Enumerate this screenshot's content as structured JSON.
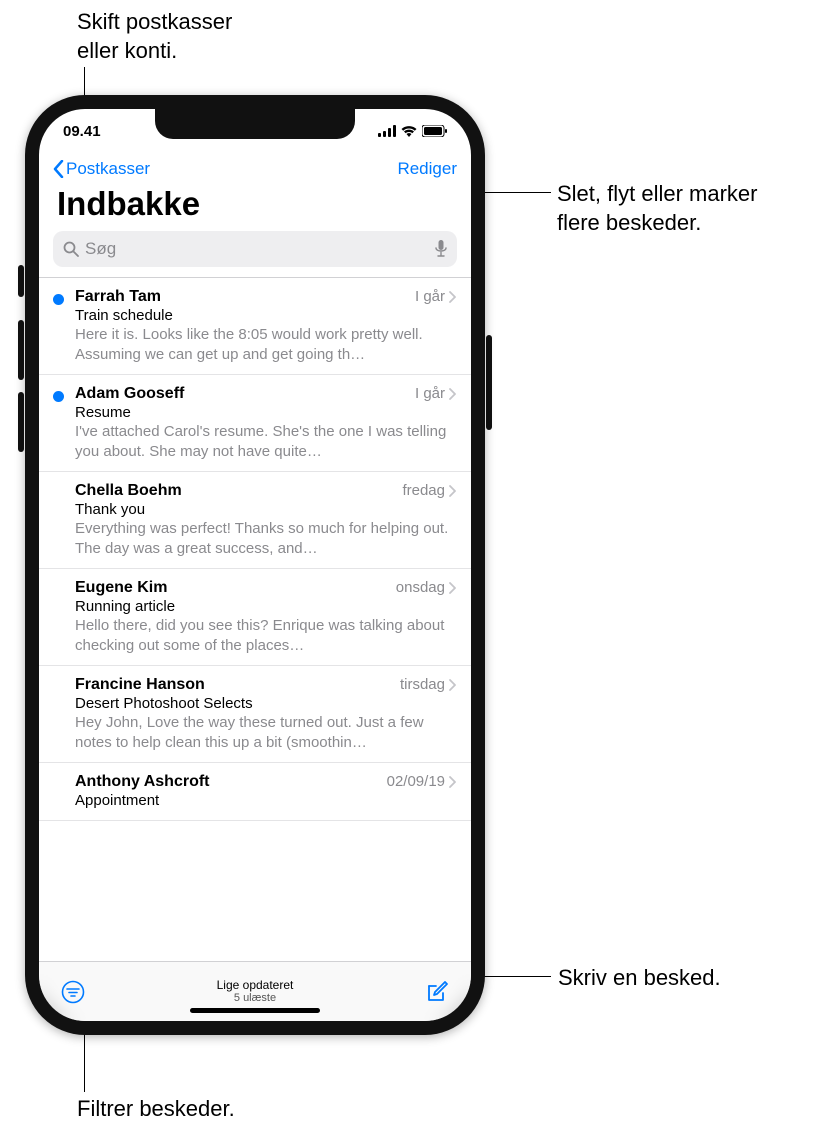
{
  "callouts": {
    "mailboxes": "Skift postkasser\neller konti.",
    "edit": "Slet, flyt eller marker\nflere beskeder.",
    "compose": "Skriv en besked.",
    "filter": "Filtrer beskeder."
  },
  "status": {
    "time": "09.41"
  },
  "nav": {
    "back": "Postkasser",
    "edit": "Rediger"
  },
  "title": "Indbakke",
  "search": {
    "placeholder": "Søg"
  },
  "toolbar": {
    "status": "Lige opdateret",
    "sub": "5 ulæste"
  },
  "colors": {
    "accent": "#007aff"
  },
  "messages": [
    {
      "sender": "Farrah Tam",
      "date": "I går",
      "subject": "Train schedule",
      "preview": "Here it is. Looks like the 8:05 would work pretty well. Assuming we can get up and get going th…",
      "unread": true
    },
    {
      "sender": "Adam Gooseff",
      "date": "I går",
      "subject": "Resume",
      "preview": "I've attached Carol's resume. She's the one I was telling you about. She may not have quite…",
      "unread": true
    },
    {
      "sender": "Chella Boehm",
      "date": "fredag",
      "subject": "Thank you",
      "preview": "Everything was perfect! Thanks so much for helping out. The day was a great success, and…",
      "unread": false
    },
    {
      "sender": "Eugene Kim",
      "date": "onsdag",
      "subject": "Running article",
      "preview": "Hello there, did you see this? Enrique was talking about checking out some of the places…",
      "unread": false
    },
    {
      "sender": "Francine Hanson",
      "date": "tirsdag",
      "subject": "Desert Photoshoot Selects",
      "preview": "Hey John, Love the way these turned out. Just a few notes to help clean this up a bit (smoothin…",
      "unread": false
    },
    {
      "sender": "Anthony Ashcroft",
      "date": "02/09/19",
      "subject": "Appointment",
      "preview": "",
      "unread": false
    }
  ]
}
